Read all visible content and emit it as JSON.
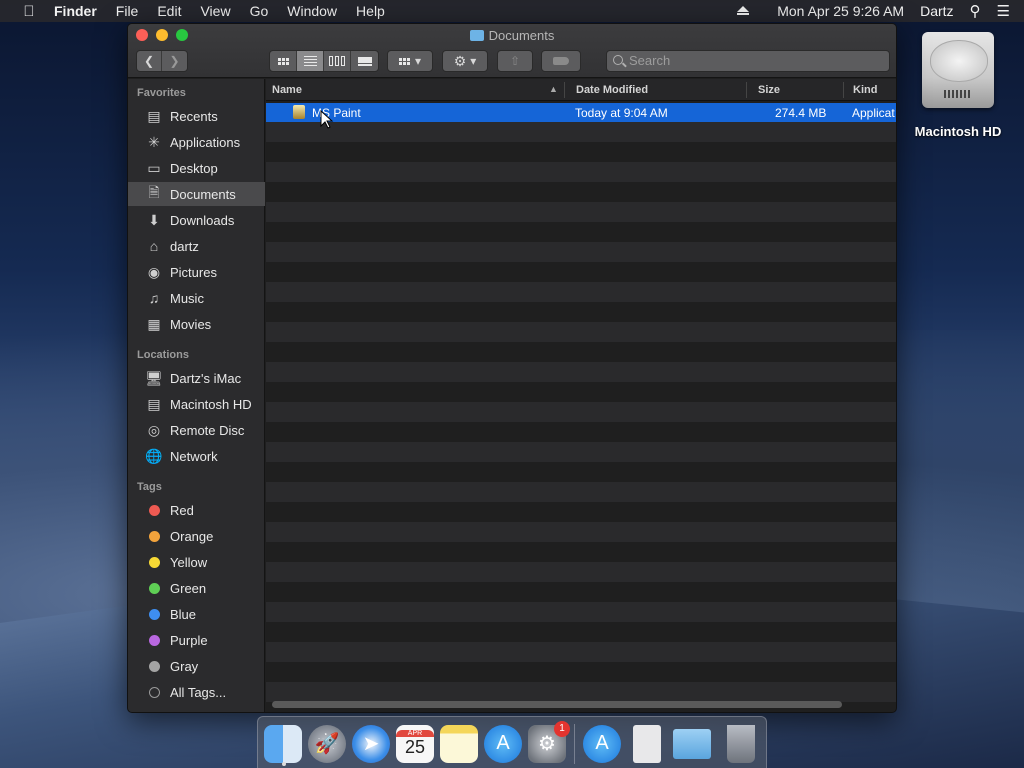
{
  "menubar": {
    "app": "Finder",
    "items": [
      "File",
      "Edit",
      "View",
      "Go",
      "Window",
      "Help"
    ],
    "datetime": "Mon Apr 25  9:26 AM",
    "user": "Dartz"
  },
  "desktop": {
    "hd_label": "Macintosh HD"
  },
  "window": {
    "title": "Documents",
    "search_placeholder": "Search"
  },
  "sidebar": {
    "favorites_title": "Favorites",
    "favorites": [
      "Recents",
      "Applications",
      "Desktop",
      "Documents",
      "Downloads",
      "dartz",
      "Pictures",
      "Music",
      "Movies"
    ],
    "selected": "Documents",
    "locations_title": "Locations",
    "locations": [
      "Dartz's iMac",
      "Macintosh HD",
      "Remote Disc",
      "Network"
    ],
    "tags_title": "Tags",
    "tags": [
      {
        "label": "Red",
        "color": "#ee5a52"
      },
      {
        "label": "Orange",
        "color": "#f2a33c"
      },
      {
        "label": "Yellow",
        "color": "#f7d935"
      },
      {
        "label": "Green",
        "color": "#5fcf55"
      },
      {
        "label": "Blue",
        "color": "#3e8ef0"
      },
      {
        "label": "Purple",
        "color": "#b967e0"
      },
      {
        "label": "Gray",
        "color": "#a4a4a4"
      }
    ],
    "all_tags": "All Tags..."
  },
  "columns": {
    "name": "Name",
    "date": "Date Modified",
    "size": "Size",
    "kind": "Kind"
  },
  "files": [
    {
      "name": "MS Paint",
      "date": "Today at 9:04 AM",
      "size": "274.4 MB",
      "kind": "Applicat"
    }
  ],
  "dock": {
    "calendar_month": "APR",
    "calendar_day": "25",
    "prefs_badge": "1"
  },
  "colors": {
    "selection": "#1565d7",
    "accent": "#3e8ef0"
  }
}
